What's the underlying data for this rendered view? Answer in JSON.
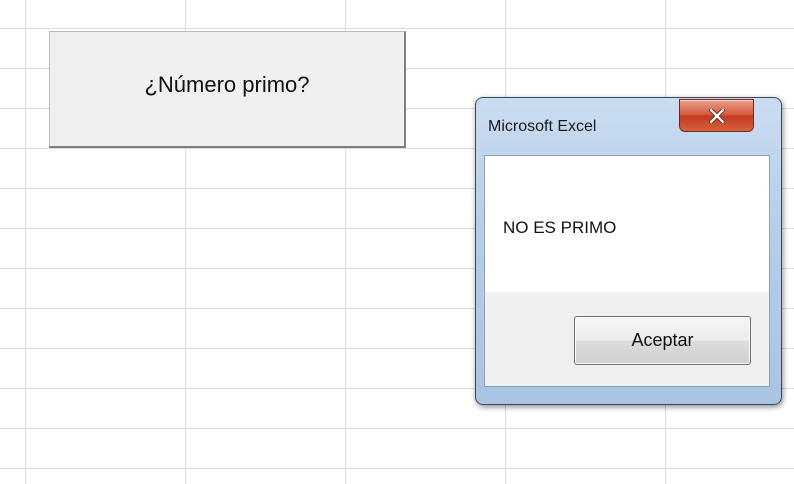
{
  "sheet_button": {
    "label": "¿Número primo?"
  },
  "message_box": {
    "title": "Microsoft Excel",
    "message": "NO ES PRIMO",
    "ok_label": "Aceptar",
    "close_icon": "close-x-icon"
  },
  "colors": {
    "close_button": "#d6583c",
    "dialog_frame": "#b4cde9",
    "grid_lines": "#d7dbe0"
  }
}
